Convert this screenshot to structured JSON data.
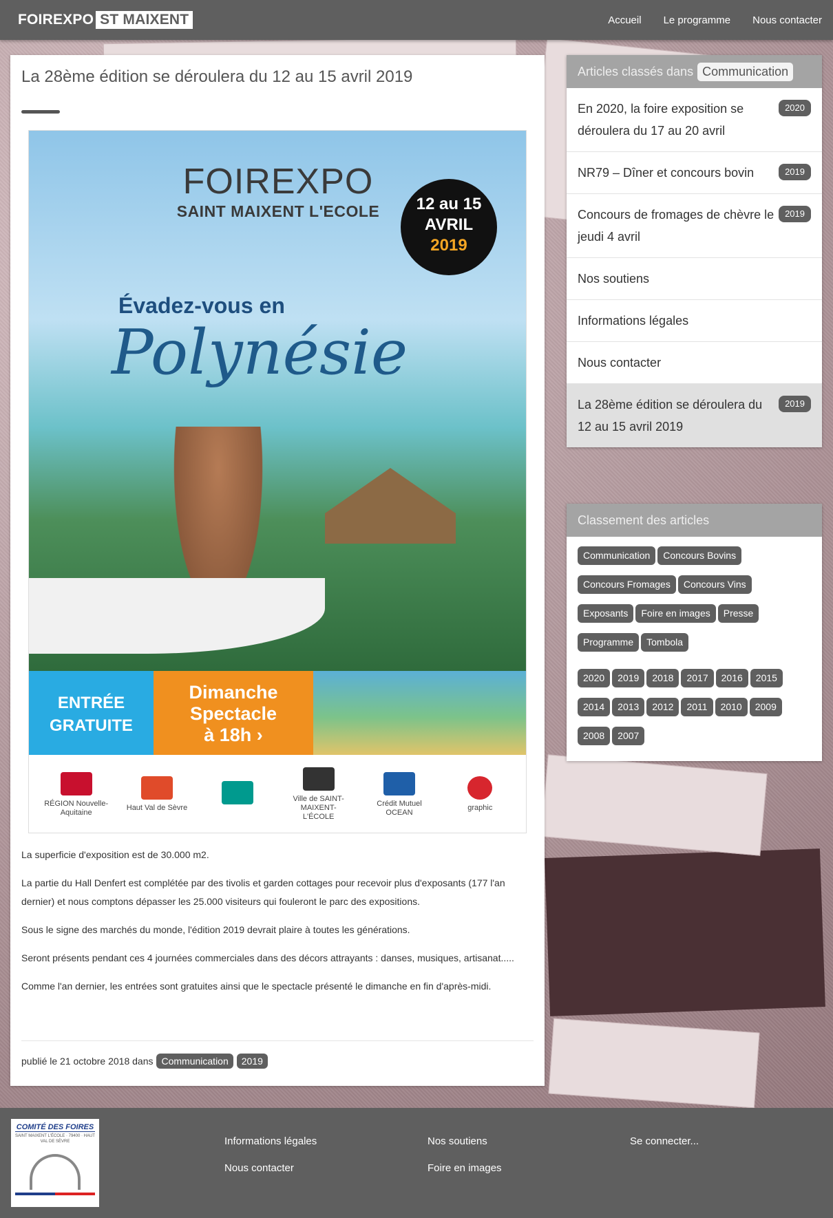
{
  "header": {
    "brand_main": "FOIREXPO",
    "brand_box": "ST MAIXENT",
    "nav": [
      "Accueil",
      "Le programme",
      "Nous contacter"
    ]
  },
  "article": {
    "title": "La 28ème édition se déroulera du 12 au 15 avril 2019",
    "poster": {
      "logo": "FOIREXPO",
      "subtitle": "SAINT MAIXENT L'ECOLE",
      "date_line1": "12 au 15",
      "date_line2": "AVRIL",
      "date_year": "2019",
      "evade": "Évadez-vous en",
      "polynesie": "Polynésie",
      "entree_line1": "ENTRÉE",
      "entree_line2": "GRATUITE",
      "dimanche_line1": "Dimanche",
      "dimanche_line2": "Spectacle",
      "dimanche_line3": "à 18h ›",
      "partners": [
        {
          "label": "RÉGION Nouvelle-Aquitaine",
          "color": "#c8102e"
        },
        {
          "label": "Haut Val de Sèvre",
          "color": "#e04b2a"
        },
        {
          "label": "",
          "color": "#009a8e"
        },
        {
          "label": "Ville de SAINT-MAIXENT-L'ÉCOLE",
          "color": "#333333"
        },
        {
          "label": "Crédit Mutuel OCEAN",
          "color": "#1f5fa8"
        },
        {
          "label": "graphic",
          "color": "#d7262e"
        }
      ]
    },
    "paragraphs": [
      "La superficie d'exposition est de 30.000 m2.",
      "La partie du Hall Denfert est complétée par des tivolis et garden cottages pour recevoir plus d'exposants (177 l'an dernier) et nous comptons dépasser les 25.000 visiteurs qui fouleront le parc des expositions.",
      "Sous le signe des marchés du monde, l'édition 2019 devrait plaire à toutes les générations.",
      "Seront présents pendant ces 4 journées commerciales dans des décors attrayants : danses, musiques, artisanat.....",
      "Comme l'an dernier, les entrées sont gratuites ainsi que le spectacle présenté le dimanche en fin d'après-midi."
    ],
    "footer_text": "publié le 21 octobre 2018 dans",
    "footer_tags": [
      "Communication",
      "2019"
    ]
  },
  "sidebar": {
    "articles_head": "Articles classés dans",
    "articles_head_pill": "Communication",
    "articles": [
      {
        "label": "En 2020, la foire exposition se déroulera du 17 au 20 avril",
        "badge": "2020"
      },
      {
        "label": "NR79 – Dîner et concours bovin",
        "badge": "2019"
      },
      {
        "label": "Concours de fromages de chèvre le jeudi 4 avril",
        "badge": "2019"
      },
      {
        "label": "Nos soutiens",
        "badge": ""
      },
      {
        "label": "Informations légales",
        "badge": ""
      },
      {
        "label": "Nous contacter",
        "badge": ""
      },
      {
        "label": "La 28ème édition se déroulera du 12 au 15 avril 2019",
        "badge": "2019"
      }
    ],
    "classement_head": "Classement des articles",
    "categories": [
      "Communication",
      "Concours Bovins",
      "Concours Fromages",
      "Concours Vins",
      "Exposants",
      "Foire en images",
      "Presse",
      "Programme",
      "Tombola"
    ],
    "years": [
      "2020",
      "2019",
      "2018",
      "2017",
      "2016",
      "2015",
      "2014",
      "2013",
      "2012",
      "2011",
      "2010",
      "2009",
      "2008",
      "2007"
    ]
  },
  "footer": {
    "logo_title": "COMITÉ DES FOIRES",
    "logo_sub": "SAINT MAIXENT L'ÉCOLE · 79400 · HAUT VAL DE SÈVRE",
    "col1": [
      "Informations légales",
      "Nous contacter"
    ],
    "col2": [
      "Nos soutiens",
      "Foire en images"
    ],
    "col3": [
      "Se connecter..."
    ]
  }
}
